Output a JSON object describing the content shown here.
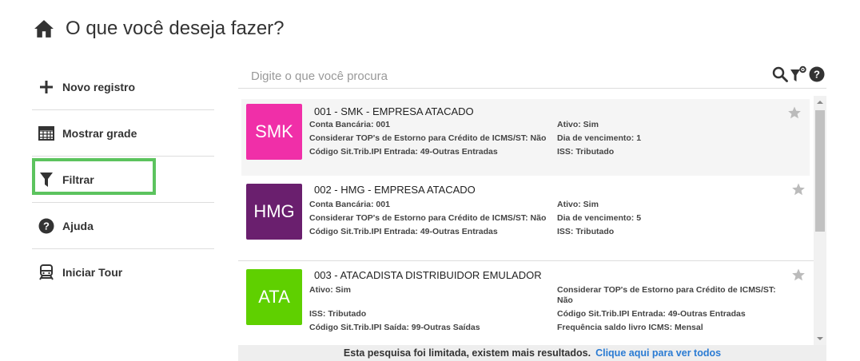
{
  "header": {
    "title": "O que você deseja fazer?"
  },
  "sidebar": {
    "items": [
      {
        "label": "Novo registro",
        "icon": "plus-icon"
      },
      {
        "label": "Mostrar grade",
        "icon": "grid-icon"
      },
      {
        "label": "Filtrar",
        "icon": "filter-icon",
        "selected": true
      },
      {
        "label": "Ajuda",
        "icon": "help-icon"
      },
      {
        "label": "Iniciar Tour",
        "icon": "train-icon"
      }
    ]
  },
  "search": {
    "placeholder": "Digite o que você procura"
  },
  "records": [
    {
      "logo": "SMK",
      "logo_color": "#f02fa8",
      "name": "001 - SMK - EMPRESA ATACADO",
      "left": [
        "Conta Bancária: 001",
        "Considerar TOP's de Estorno para Crédito de ICMS/ST: Não",
        "Código Sit.Trib.IPI Entrada: 49-Outras Entradas"
      ],
      "right": [
        "Ativo: Sim",
        "Dia de vencimento: 1",
        "ISS: Tributado"
      ]
    },
    {
      "logo": "HMG",
      "logo_color": "#6a1f6e",
      "name": "002 - HMG - EMPRESA ATACADO",
      "left": [
        "Conta Bancária: 001",
        "Considerar TOP's de Estorno para Crédito de ICMS/ST: Não",
        "Código Sit.Trib.IPI Entrada: 49-Outras Entradas"
      ],
      "right": [
        "Ativo: Sim",
        "Dia de vencimento: 5",
        "ISS: Tributado"
      ]
    },
    {
      "logo": "ATA",
      "logo_color": "#5fd000",
      "name": "003 - ATACADISTA DISTRIBUIDOR EMULADOR",
      "left": [
        "Ativo: Sim",
        "ISS: Tributado",
        "Código Sit.Trib.IPI Saída: 99-Outras Saídas"
      ],
      "right": [
        "Considerar TOP's de Estorno para Crédito de ICMS/ST: Não",
        "Código Sit.Trib.IPI Entrada: 49-Outras Entradas",
        "Frequência saldo livro ICMS: Mensal"
      ]
    }
  ],
  "footer": {
    "message": "Esta pesquisa foi limitada, existem mais resultados.",
    "link": "Clique aqui para ver todos"
  }
}
